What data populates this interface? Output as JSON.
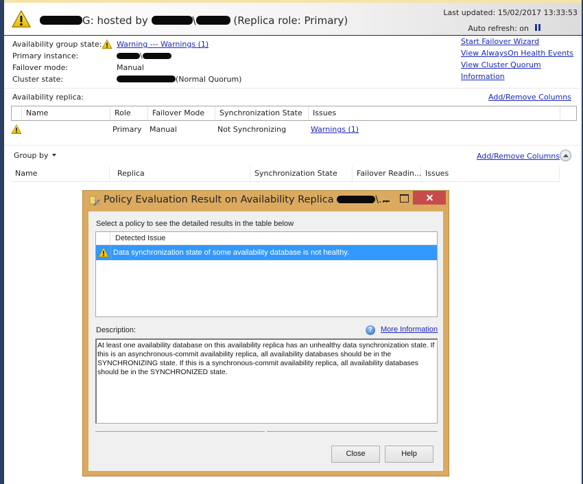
{
  "header": {
    "title_prefix_redacted": "",
    "title_mid": "G: hosted by ",
    "title_sep": "\\",
    "title_suffix": " (Replica role: Primary)",
    "last_updated": "Last updated: 15/02/2017 13:33:53",
    "auto_refresh": "Auto refresh: on",
    "icon": "warning-triangle-icon",
    "pause_icon": "pause-icon"
  },
  "summary": {
    "rows": [
      {
        "label": "Availability group state:",
        "value": "Warning --- Warnings (1)",
        "is_link": true
      },
      {
        "label": "Primary instance:",
        "value": "\\",
        "redacted": true
      },
      {
        "label": "Failover mode:",
        "value": "Manual"
      },
      {
        "label": "Cluster state:",
        "value": "(Normal Quorum)",
        "redacted": true
      }
    ]
  },
  "actions": {
    "links": [
      "Start Failover Wizard",
      "View AlwaysOn Health Events",
      "View Cluster Quorum Information"
    ]
  },
  "replicas": {
    "label": "Availability replica:",
    "add_remove": "Add/Remove Columns",
    "columns": [
      "Name",
      "Role",
      "Failover Mode",
      "Synchronization State",
      "Issues"
    ],
    "rows": [
      {
        "name": "",
        "role": "Primary",
        "failover_mode": "Manual",
        "sync_state": "Not Synchronizing",
        "issues": "Warnings (1)"
      }
    ]
  },
  "databases": {
    "group_by": "Group by",
    "add_remove": "Add/Remove Columns",
    "columns": [
      "Name",
      "Replica",
      "Synchronization State",
      "Failover Readin...",
      "Issues"
    ]
  },
  "dialog": {
    "title": "Policy Evaluation Result on Availability Replica ",
    "title_ellipsis": "\\...",
    "instruction": "Select a policy to see the detailed results in the table below",
    "list_header": "Detected Issue",
    "issues": [
      "Data synchronization state of some availability database is not healthy."
    ],
    "description_label": "Description:",
    "more_info": "More Information",
    "description": "At least one availability database on this availability replica has an unhealthy data synchronization state. If this is an asynchronous-commit availability replica, all availability databases should be in the SYNCHRONIZING state. If this is a synchronous-commit availability replica, all availability databases should be in the SYNCHRONIZED state.",
    "close_label": "Close",
    "help_label": "Help",
    "frame_color": "#dbaa5f",
    "selected_color": "#3399ff"
  }
}
